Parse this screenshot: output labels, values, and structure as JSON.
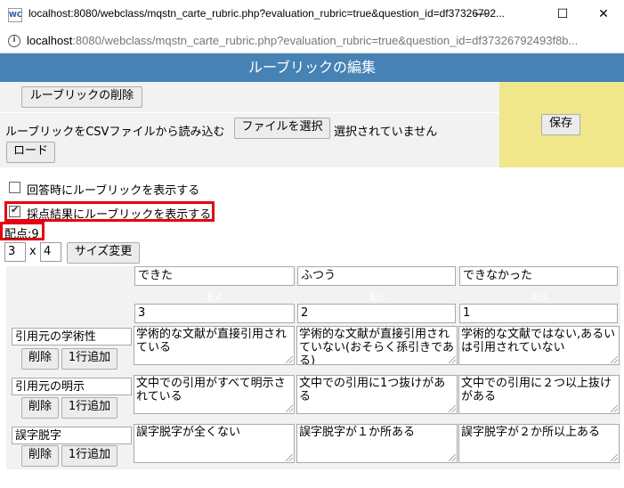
{
  "window": {
    "title": "localhost:8080/webclass/mqstn_carte_rubric.php?evaluation_rubric=true&question_id=df37326792...",
    "app_icon_text": "WC",
    "minimize": "—",
    "maximize": "☐",
    "close": "✕"
  },
  "address": {
    "host": "localhost",
    "rest": ":8080/webclass/mqstn_carte_rubric.php?evaluation_rubric=true&question_id=df37326792493f8b..."
  },
  "header": {
    "title": "ルーブリックの編集"
  },
  "controls": {
    "delete_rubric": "ルーブリックの削除",
    "csv_label": "ルーブリックをCSVファイルから読み込む",
    "file_button": "ファイルを選択",
    "file_status": "選択されていません",
    "load_button": "ロード",
    "save_button": "保存"
  },
  "options": [
    {
      "label": "回答時にルーブリックを表示する",
      "checked": false
    },
    {
      "label": "採点結果にルーブリックを表示する",
      "checked": true
    }
  ],
  "score": {
    "label": "配点:9"
  },
  "size": {
    "rows": "3",
    "times": "x",
    "cols": "4",
    "change_button": "サイズ変更"
  },
  "grid": {
    "levels": [
      {
        "label": "できた",
        "points": "3",
        "points_caption": "配点"
      },
      {
        "label": "ふつう",
        "points": "2",
        "points_caption": "配点"
      },
      {
        "label": "できなかった",
        "points": "1",
        "points_caption": "配点"
      }
    ],
    "row_delete_label": "削除",
    "row_add_label": "1行追加",
    "criteria": [
      {
        "name": "引用元の学術性",
        "cells": [
          "学術的な文献が直接引用されている",
          "学術的な文献が直接引用されていない(おそらく孫引きである)",
          "学術的な文献ではない,あるいは引用されていない"
        ]
      },
      {
        "name": "引用元の明示",
        "cells": [
          "文中での引用がすべて明示されている",
          "文中での引用に1つ抜けがある",
          "文中での引用に２つ以上抜けがある"
        ]
      },
      {
        "name": "誤字脱字",
        "cells": [
          "誤字脱字が全くない",
          "誤字脱字が１か所ある",
          "誤字脱字が２か所以上ある"
        ]
      }
    ]
  }
}
